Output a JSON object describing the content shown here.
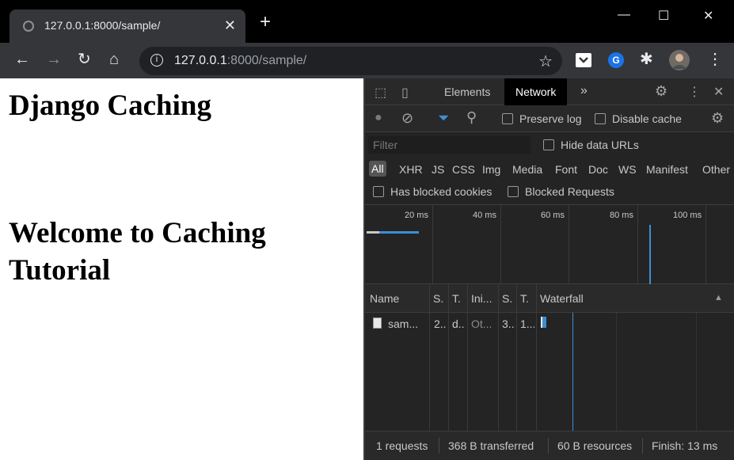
{
  "browser": {
    "tab_title": "127.0.0.1:8000/sample/",
    "close_glyph": "✕",
    "new_tab_glyph": "+",
    "window_controls": {
      "minimize": "—",
      "maximize": "☐",
      "close": "✕"
    },
    "url_host": "127.0.0.1",
    "url_rest": ":8000/sample/",
    "info_glyph": "i",
    "star_glyph": "☆",
    "extensions_glyph": "✱",
    "menu_glyph": "⋮",
    "nav": {
      "back": "←",
      "forward": "→",
      "reload": "↻",
      "home": "⌂"
    },
    "colors": {
      "tab_bg": "#35363a",
      "titlebar_bg": "#000000",
      "omnibox_bg": "#202124"
    }
  },
  "page": {
    "heading1": "Django Caching",
    "heading2_line1": "Welcome to Caching",
    "heading2_line2": "Tutorial"
  },
  "devtools": {
    "tabs": {
      "elements": "Elements",
      "network": "Network",
      "more": "»"
    },
    "icons": {
      "inspect": "⬚",
      "device": "▯",
      "settings": "⚙",
      "menu": "⋮",
      "close": "✕"
    },
    "controls": {
      "record_glyph": "●",
      "clear_glyph": "⊘",
      "filter_glyph": "⏷",
      "search_glyph": "⚲",
      "preserve_log": "Preserve log",
      "disable_cache": "Disable cache"
    },
    "filter_placeholder": "Filter",
    "hide_data_urls": "Hide data URLs",
    "types": [
      "All",
      "XHR",
      "JS",
      "CSS",
      "Img",
      "Media",
      "Font",
      "Doc",
      "WS",
      "Manifest",
      "Other"
    ],
    "has_blocked_cookies": "Has blocked cookies",
    "blocked_requests": "Blocked Requests",
    "overview_ticks": [
      "20 ms",
      "40 ms",
      "60 ms",
      "80 ms",
      "100 ms"
    ],
    "columns": [
      "Name",
      "S.",
      "T.",
      "Ini...",
      "S.",
      "T.",
      "Waterfall"
    ],
    "sort_glyph": "▲",
    "rows": [
      {
        "name": "sam...",
        "status": "2...",
        "type": "d...",
        "initiator": "Ot...",
        "size": "3...",
        "time": "1..."
      }
    ],
    "status": {
      "requests": "1 requests",
      "transferred": "368 B transferred",
      "resources": "60 B resources",
      "finish": "Finish: 13 ms"
    },
    "colors": {
      "bg": "#242424",
      "accent": "#3c8fd6",
      "active_tab_bg": "#000000"
    }
  }
}
